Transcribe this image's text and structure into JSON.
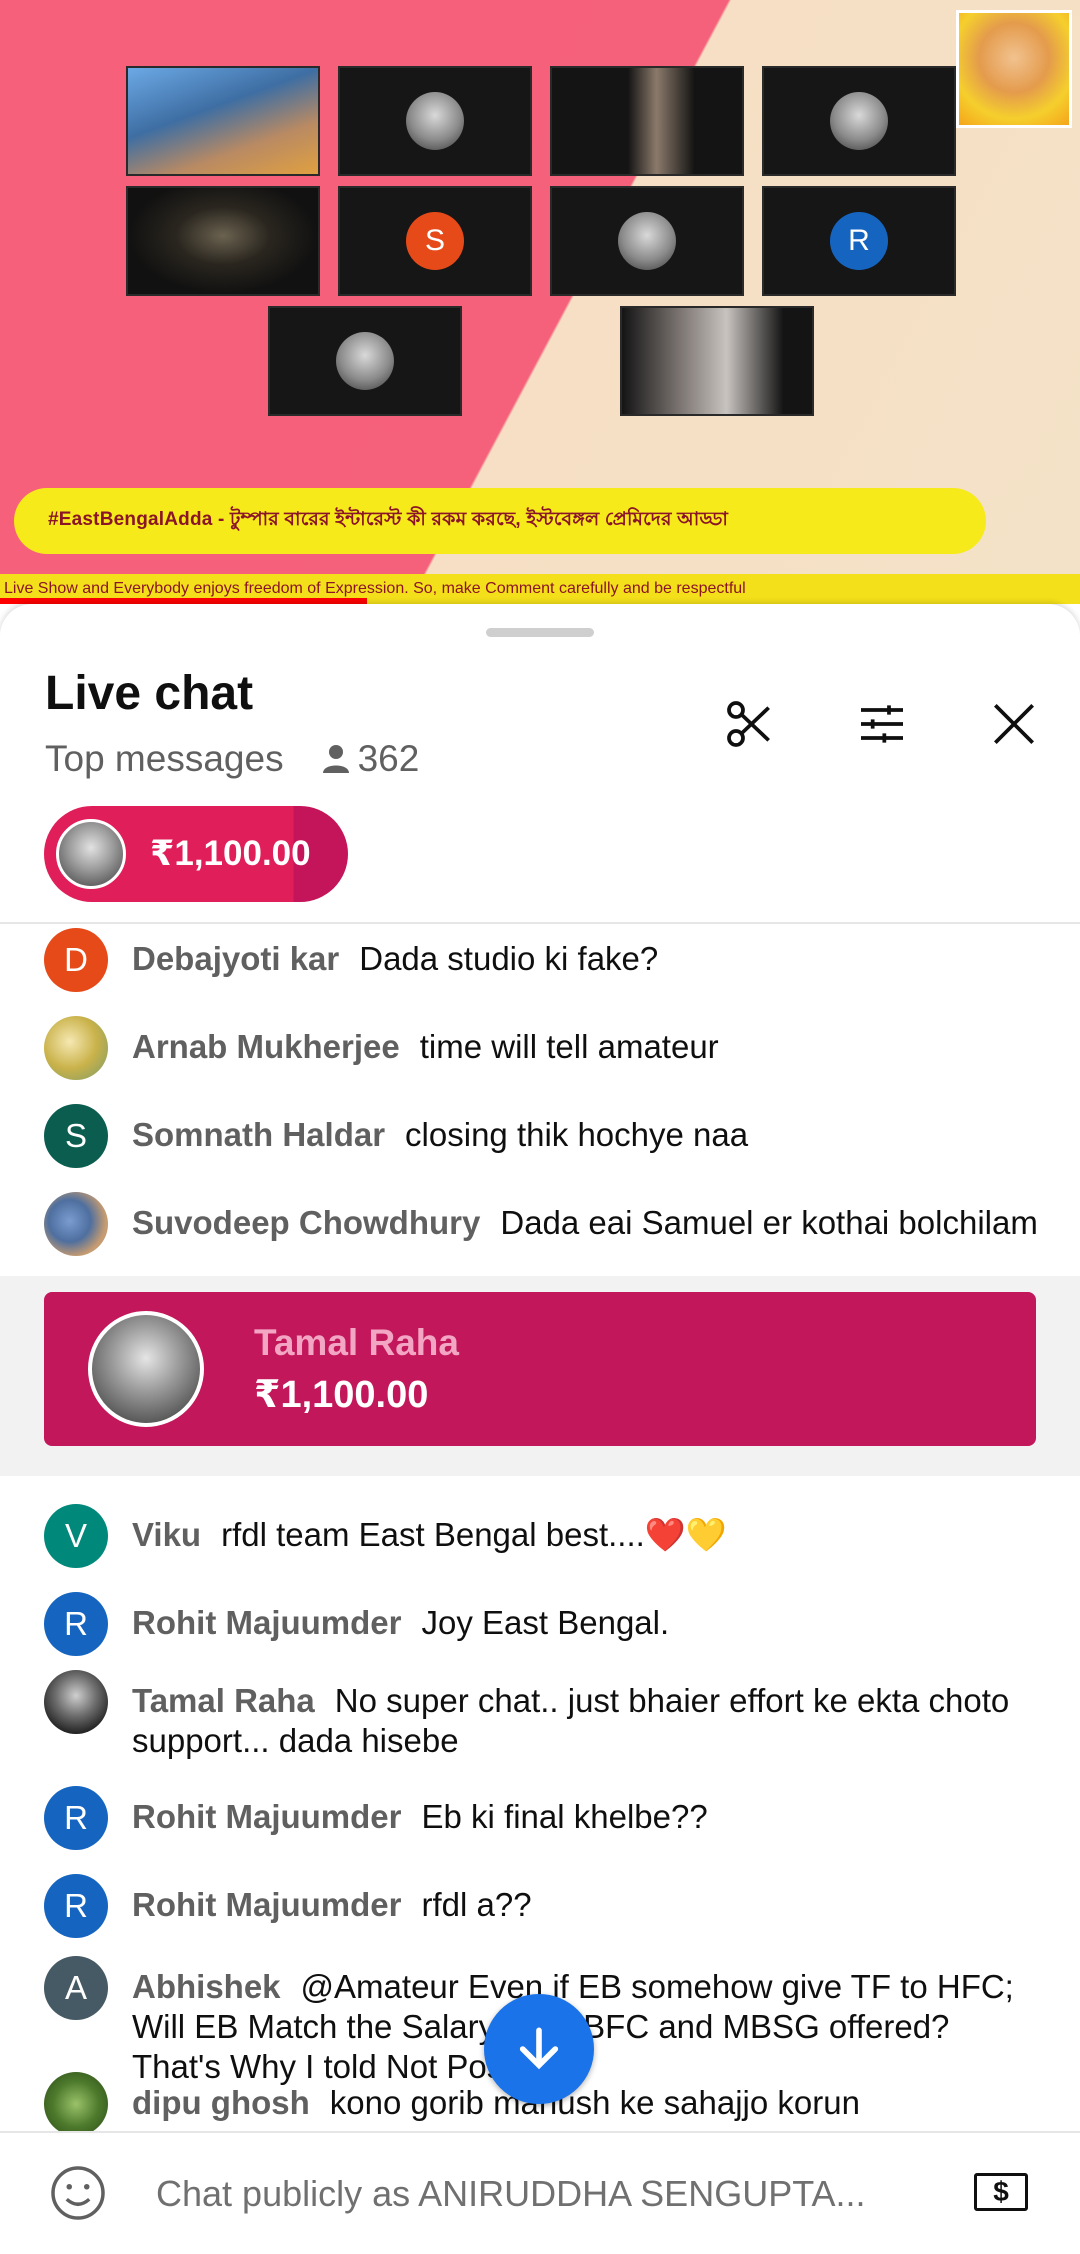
{
  "video": {
    "banner_text": "#EastBengalAdda - টুম্পার বারের ইন্টারেস্ট কী রকম করছে, ইস্টবেঙ্গল প্রেমিদের আড্ডা",
    "ticker_text": "Live Show and Everybody enjoys freedom of Expression. So, make Comment carefully and be respectful",
    "participant_initials": [
      "S",
      "R"
    ],
    "participant_colors": {
      "S": "#e64a19",
      "R": "#1565c0"
    },
    "progress": 0.34
  },
  "chat": {
    "title": "Live chat",
    "mode": "Top messages",
    "viewers": "362",
    "pinned_amount": "₹1,100.00",
    "header_icons": [
      "scissors-icon",
      "tune-icon",
      "close-icon"
    ],
    "messages": [
      {
        "initial": "D",
        "color": "#e64a19",
        "author": "Debajyoti kar",
        "text": "Dada studio ki fake?"
      },
      {
        "initial": "",
        "color": "",
        "author": "Arnab Mukherjee",
        "text": "time will tell amateur"
      },
      {
        "initial": "S",
        "color": "#00695c",
        "author": "Somnath Haldar",
        "text": "closing thik hochye naa"
      },
      {
        "initial": "",
        "color": "",
        "author": "Suvodeep Chowdhury",
        "text": "Dada eai Samuel er kothai bolchilam"
      },
      {
        "initial": "V",
        "color": "#00897b",
        "author": "Viku",
        "text": "rfdl team East Bengal best....❤️💛"
      },
      {
        "initial": "R",
        "color": "#1565c0",
        "author": "Rohit Majuumder",
        "text": "Joy East Bengal."
      },
      {
        "initial": "",
        "color": "",
        "author": "Tamal Raha",
        "text": "No super chat.. just bhaier effort ke ekta choto support... dada hisebe"
      },
      {
        "initial": "R",
        "color": "#1565c0",
        "author": "Rohit Majuumder",
        "text": "Eb ki final khelbe??"
      },
      {
        "initial": "R",
        "color": "#1565c0",
        "author": "Rohit Majuumder",
        "text": "rfdl a??"
      },
      {
        "initial": "A",
        "color": "#455a64",
        "author": "Abhishek",
        "text": "@Amateur Even if EB somehow give TF to HFC; Will EB Match the Salary what BFC and MBSG offered? That's Why I told Not Possible"
      },
      {
        "initial": "",
        "color": "",
        "author": "dipu ghosh",
        "text": "kono gorib manush ke sahajjo korun"
      }
    ],
    "superchat": {
      "name": "Tamal Raha",
      "amount": "₹1,100.00",
      "color": "#c2185b"
    },
    "input_placeholder": "Chat publicly as ANIRUDDHA SENGUPTA...",
    "currency_icon_label": "$"
  }
}
